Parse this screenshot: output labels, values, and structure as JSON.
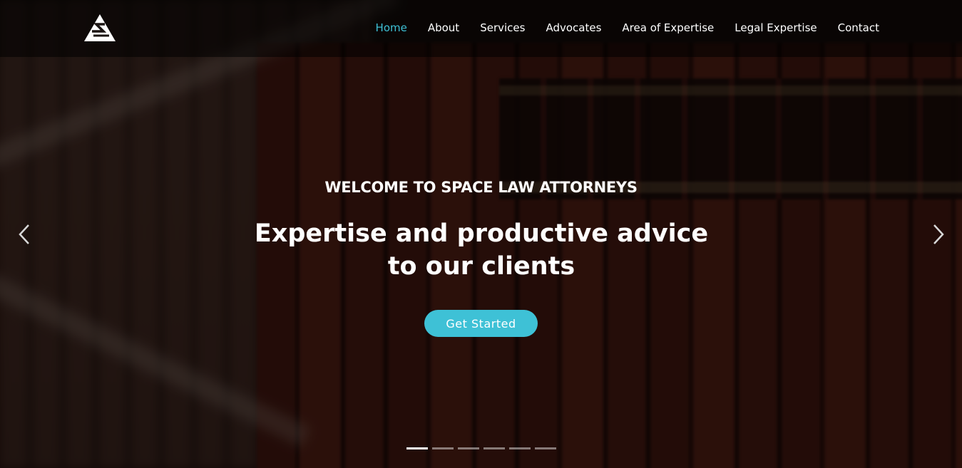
{
  "nav": {
    "logo_icon": "triangle-s-logo",
    "links": [
      {
        "label": "Home",
        "active": true
      },
      {
        "label": "About",
        "active": false
      },
      {
        "label": "Services",
        "active": false
      },
      {
        "label": "Advocates",
        "active": false
      },
      {
        "label": "Area of Expertise",
        "active": false
      },
      {
        "label": "Legal Expertise",
        "active": false
      },
      {
        "label": "Contact",
        "active": false
      }
    ]
  },
  "hero": {
    "kicker": "WELCOME TO SPACE LAW ATTORNEYS",
    "headline": "Expertise and productive advice to our clients",
    "cta_label": "Get Started",
    "prev_icon": "chevron-left-icon",
    "next_icon": "chevron-right-icon",
    "slide_count": 6,
    "active_slide": 1
  },
  "colors": {
    "accent": "#3ec1d6",
    "text": "#ffffff",
    "navbar_bg": "rgba(0,0,0,0.55)"
  }
}
